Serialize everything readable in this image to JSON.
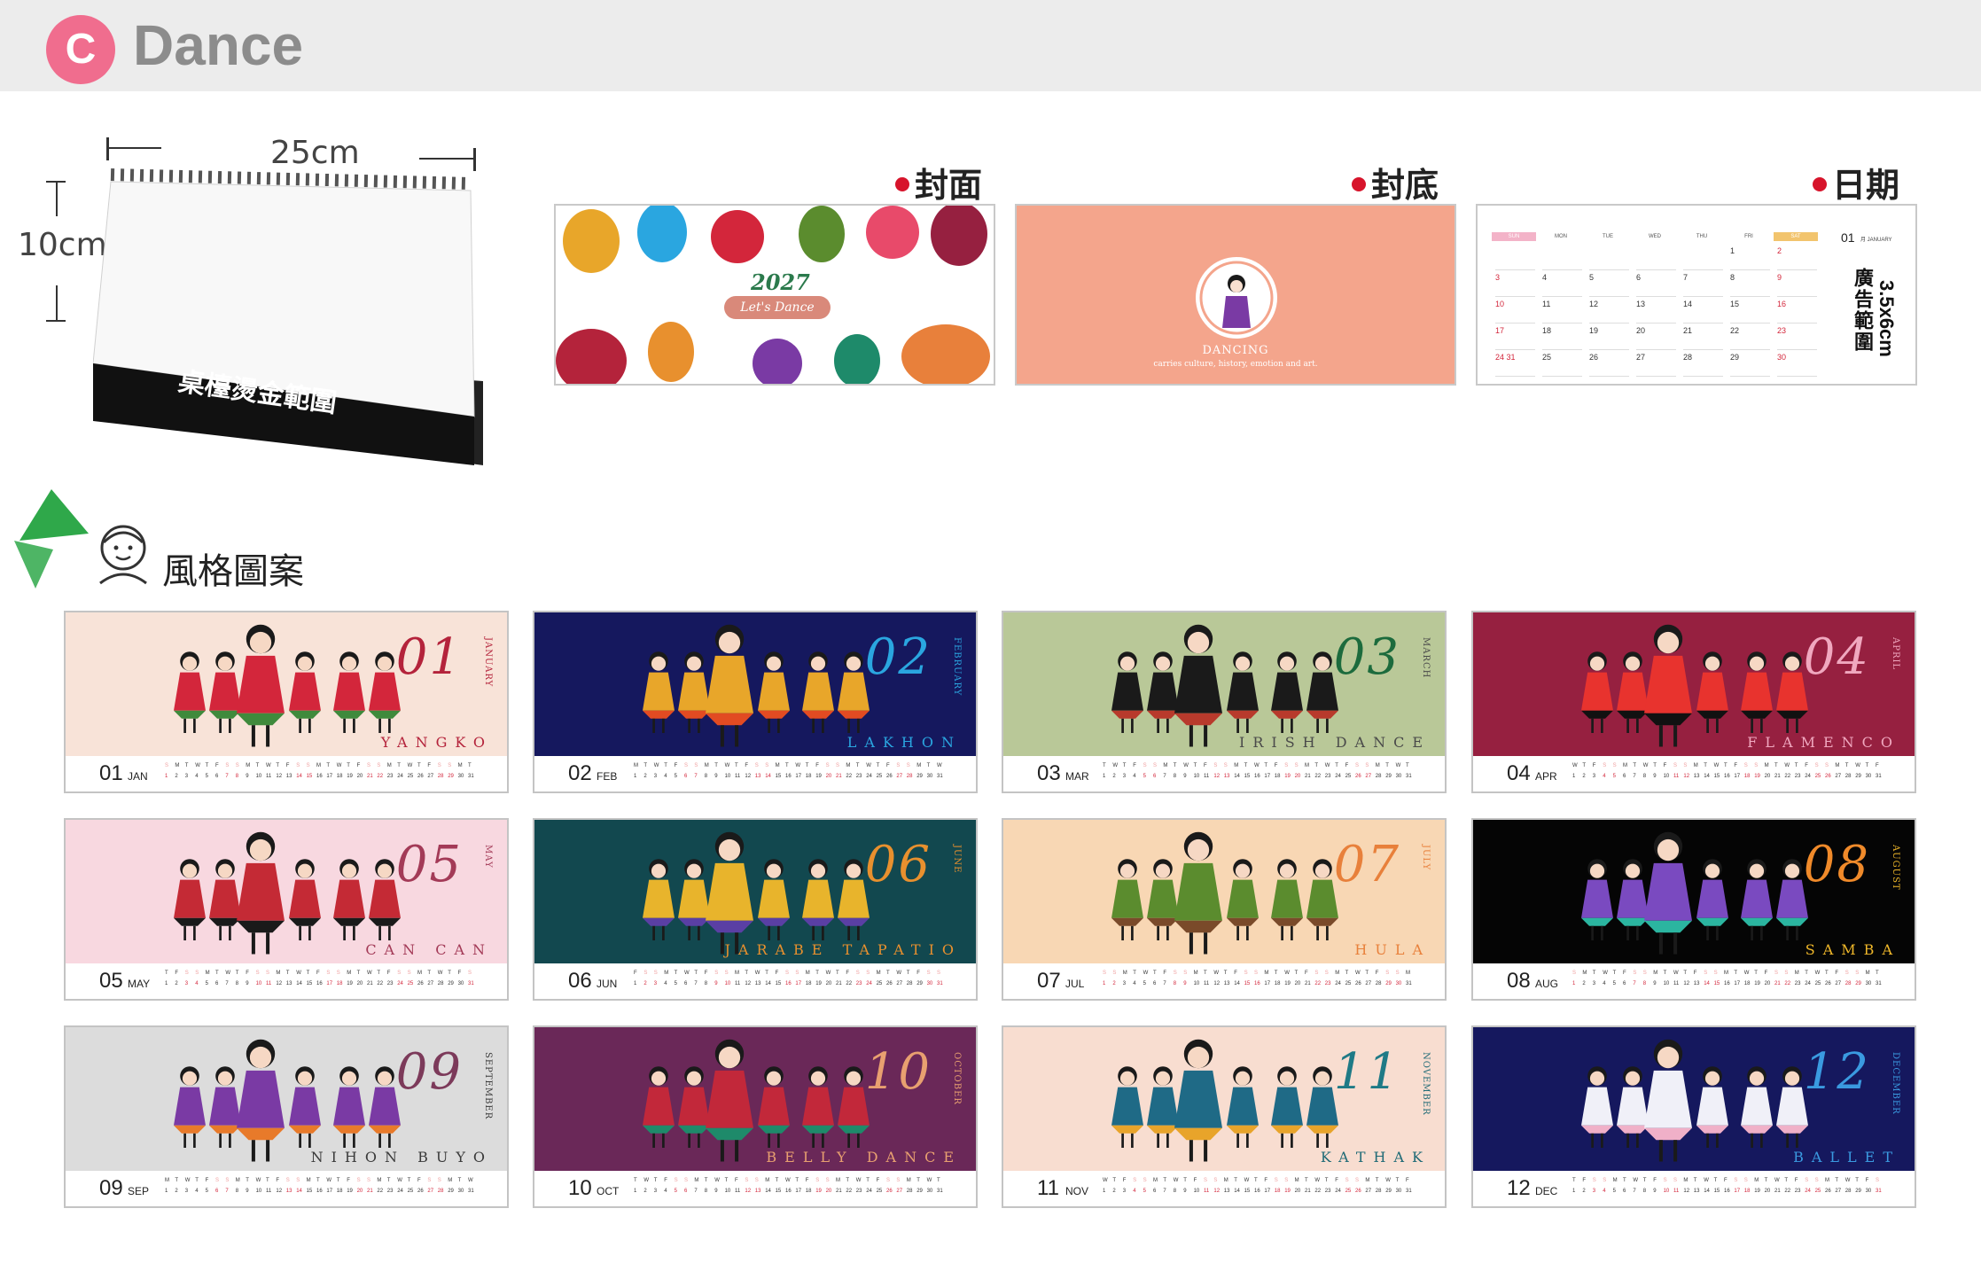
{
  "header": {
    "badge": "C",
    "title": "Dance"
  },
  "product": {
    "width_label": "25cm",
    "height_label": "10cm",
    "base_label": "桌檯燙金範圍"
  },
  "samples": {
    "front": {
      "label": "封面",
      "year": "2027",
      "subtitle": "Let's Dance"
    },
    "back": {
      "label": "封底",
      "title": "DANCING",
      "caption": "carries culture, history, emotion and art."
    },
    "date": {
      "label": "日期",
      "ad_size": "3.5x6cm",
      "ad_label": "廣告範圍",
      "month_num": "01",
      "month_name": "月 JANUARY",
      "weekdays": [
        "SUN",
        "MON",
        "TUE",
        "WED",
        "THU",
        "FRI",
        "SAT"
      ],
      "weeks": [
        [
          "",
          "",
          "",
          "",
          "",
          "1",
          "2"
        ],
        [
          "3",
          "4",
          "5",
          "6",
          "7",
          "8",
          "9"
        ],
        [
          "10",
          "11",
          "12",
          "13",
          "14",
          "15",
          "16"
        ],
        [
          "17",
          "18",
          "19",
          "20",
          "21",
          "22",
          "23"
        ],
        [
          "24 31",
          "25",
          "26",
          "27",
          "28",
          "29",
          "30"
        ]
      ]
    }
  },
  "style_section": {
    "title": "風格圖案"
  },
  "calendar_strip": {
    "weekday_letters": "SMTWTFSSMTWTFSSMTWTFSSMTWTFSSMTWTFS",
    "day_numbers": "1 2 3 4 5 6 7 8 9 10 11 12 13 14 15 16 17 18 19 20 21 22 23 24 25 26 27 28 29 30 31"
  },
  "months": [
    {
      "num": "01",
      "eng": "JANUARY",
      "abbr": "JAN",
      "dance": "YANGKO",
      "bg": "#f8e3d8",
      "num_color": "#b4233b",
      "text_color": "#b4233b",
      "figure": "#d3263b",
      "accent": "#3f8a3c"
    },
    {
      "num": "02",
      "eng": "FEBRUARY",
      "abbr": "FEB",
      "dance": "LAKHON",
      "bg": "#15185e",
      "num_color": "#2aa6e0",
      "text_color": "#2aa6e0",
      "figure": "#e8a62a",
      "accent": "#e24b22"
    },
    {
      "num": "03",
      "eng": "MARCH",
      "abbr": "MAR",
      "dance": "IRISH DANCE",
      "bg": "#b9c898",
      "num_color": "#1c6b3d",
      "text_color": "#4a4a4a",
      "figure": "#1a1a1a",
      "accent": "#b83a2c"
    },
    {
      "num": "04",
      "eng": "APRIL",
      "abbr": "APR",
      "dance": "FLAMENCO",
      "bg": "#962040",
      "num_color": "#f0a8bf",
      "text_color": "#f0a8bf",
      "figure": "#e8332e",
      "accent": "#111111"
    },
    {
      "num": "05",
      "eng": "MAY",
      "abbr": "MAY",
      "dance": "CAN CAN",
      "bg": "#f8d8e0",
      "num_color": "#a33a57",
      "text_color": "#a33a57",
      "figure": "#c42a35",
      "accent": "#1a1a1a"
    },
    {
      "num": "06",
      "eng": "JUNE",
      "abbr": "JUN",
      "dance": "JARABE TAPATIO",
      "bg": "#12484f",
      "num_color": "#e8902e",
      "text_color": "#e8902e",
      "figure": "#e8b42c",
      "accent": "#5a3fa4"
    },
    {
      "num": "07",
      "eng": "JULY",
      "abbr": "JUL",
      "dance": "HULA",
      "bg": "#f8d7b4",
      "num_color": "#e8803b",
      "text_color": "#e8803b",
      "figure": "#5b8c2e",
      "accent": "#7a4a2a"
    },
    {
      "num": "08",
      "eng": "AUGUST",
      "abbr": "AUG",
      "dance": "SAMBA",
      "bg": "#050505",
      "num_color": "#f08a2a",
      "text_color": "#f0b82a",
      "figure": "#7a4ac0",
      "accent": "#2bb5a0"
    },
    {
      "num": "09",
      "eng": "SEPTEMBER",
      "abbr": "SEP",
      "dance": "NIHON BUYO",
      "bg": "#dcdcdc",
      "num_color": "#7c3a5a",
      "text_color": "#3a3a3a",
      "figure": "#7a3aa4",
      "accent": "#e87a2a"
    },
    {
      "num": "10",
      "eng": "OCTOBER",
      "abbr": "OCT",
      "dance": "BELLY DANCE",
      "bg": "#6a2858",
      "num_color": "#e8a070",
      "text_color": "#e8a070",
      "figure": "#c2283a",
      "accent": "#1e8a6a"
    },
    {
      "num": "11",
      "eng": "NOVEMBER",
      "abbr": "NOV",
      "dance": "KATHAK",
      "bg": "#f8ddd0",
      "num_color": "#1f7a86",
      "text_color": "#1f6a76",
      "figure": "#1f6a86",
      "accent": "#e8a42a"
    },
    {
      "num": "12",
      "eng": "DECEMBER",
      "abbr": "DEC",
      "dance": "BALLET",
      "bg": "#15185e",
      "num_color": "#3a9ae0",
      "text_color": "#3a9ae0",
      "figure": "#f0f0f8",
      "accent": "#f0b0c8"
    }
  ]
}
